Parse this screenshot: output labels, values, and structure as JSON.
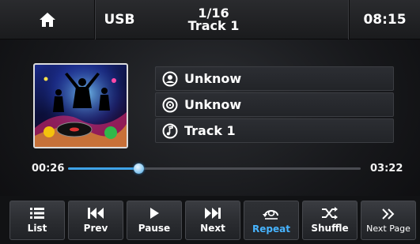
{
  "topbar": {
    "source": "USB",
    "track_counter": "1/16",
    "track_title": "Track 1",
    "clock": "08:15"
  },
  "info": {
    "artist": "Unknow",
    "album": "Unknow",
    "title": "Track 1"
  },
  "playback": {
    "elapsed": "00:26",
    "total": "03:22",
    "progress_fraction": 0.24
  },
  "controls": {
    "list": "List",
    "prev": "Prev",
    "pause": "Pause",
    "next": "Next",
    "repeat": "Repeat",
    "shuffle": "Shuffle",
    "next_page": "Next Page"
  },
  "colors": {
    "accent": "#47b4ff",
    "progress": "#3fa3e8"
  }
}
